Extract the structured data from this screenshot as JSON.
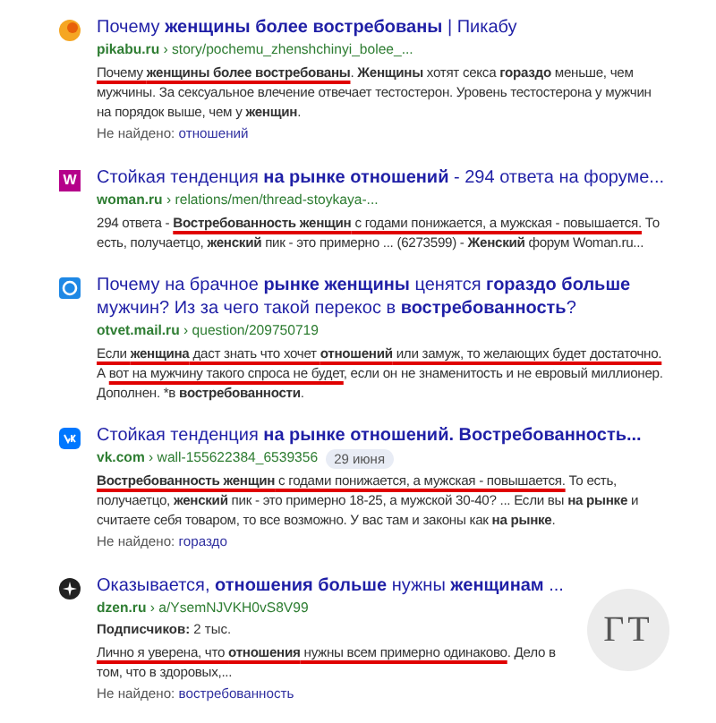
{
  "results": [
    {
      "favicon": {
        "kind": "orange-circle"
      },
      "title": "Почему **женщины более востребованы** | Пикабу",
      "domain": "pikabu.ru",
      "path": "› story/pochemu_zhenshchinyi_bolee_...",
      "snippet": [
        {
          "text": "Почему **женщины более востребованы**",
          "underlined": true
        },
        {
          "text": ". **Женщины** хотят секса **гораздо** меньше, чем мужчины. За сексуальное влечение отвечает тестостерон. Уровень тестостерона у мужчин на порядок выше, чем у **женщин**.",
          "underlined": false
        }
      ],
      "not_found": {
        "label": "Не найдено:",
        "word": "отношений"
      }
    },
    {
      "favicon": {
        "kind": "magenta-square",
        "text": "W"
      },
      "title": "Стойкая тенденция **на рынке отношений** - 294 ответа на форуме...",
      "domain": "woman.ru",
      "path": "› relations/men/thread-stoykaya-...",
      "snippet": [
        {
          "text": "294 ответа - ",
          "underlined": false
        },
        {
          "text": "**Востребованность женщин** с годами понижается, а мужская - повышается.",
          "underlined": true
        },
        {
          "text": " То есть, получаетцо, **женский** пик - это примерно ... (6273599) - **Женский** форум Woman.ru...",
          "underlined": false
        }
      ]
    },
    {
      "favicon": {
        "kind": "blue-circle"
      },
      "title": "Почему на брачное **рынке женщины** ценятся **гораздо больше** мужчин? Из за чего такой перекос в **востребованность**?",
      "domain": "otvet.mail.ru",
      "path": "› question/209750719",
      "snippet": [
        {
          "text": "Если **женщина** даст знать что хочет **отношений** или замуж, то желающих будет достаточно.",
          "underlined": true
        },
        {
          "text": " А ",
          "underlined": false
        },
        {
          "text": "вот на мужчину такого спроса не будет",
          "underlined": true
        },
        {
          "text": ", если он не знаменитость и не евровый миллионер. Дополнен. *в **востребованности**.",
          "underlined": false
        }
      ]
    },
    {
      "favicon": {
        "kind": "blue-square"
      },
      "title": "Стойкая тенденция **на рынке отношений. Востребованность...**",
      "domain": "vk.com",
      "path": "› wall-155622384_6539356",
      "date": "29 июня",
      "snippet": [
        {
          "text": "**Востребованность женщин** с годами понижается, а мужская - повышается.",
          "underlined": true
        },
        {
          "text": " То есть, получаетцо, **женский** пик - это примерно 18-25, а мужской 30-40? ... Если вы **на рынке** и считаете себя товаром, то все возможно. У вас там и законы как **на рынке**.",
          "underlined": false
        }
      ],
      "not_found": {
        "label": "Не найдено:",
        "word": "гораздо"
      }
    },
    {
      "favicon": {
        "kind": "black-circle"
      },
      "title": "Оказывается, **отношения больше** нужны **женщинам** ...",
      "domain": "dzen.ru",
      "path": "› a/YsemNJVKH0vS8V99",
      "subscribers": {
        "label": "Подписчиков:",
        "value": "2 тыс."
      },
      "snippet": [
        {
          "text": "Лично я уверена, что **отношения** нужны всем примерно одинаково",
          "underlined": true
        },
        {
          "text": ". Дело в том, что в здоровых,...",
          "underlined": false
        }
      ],
      "not_found": {
        "label": "Не найдено:",
        "word": "востребованность"
      },
      "thumbnail": {
        "letters": "ГТ"
      }
    }
  ]
}
